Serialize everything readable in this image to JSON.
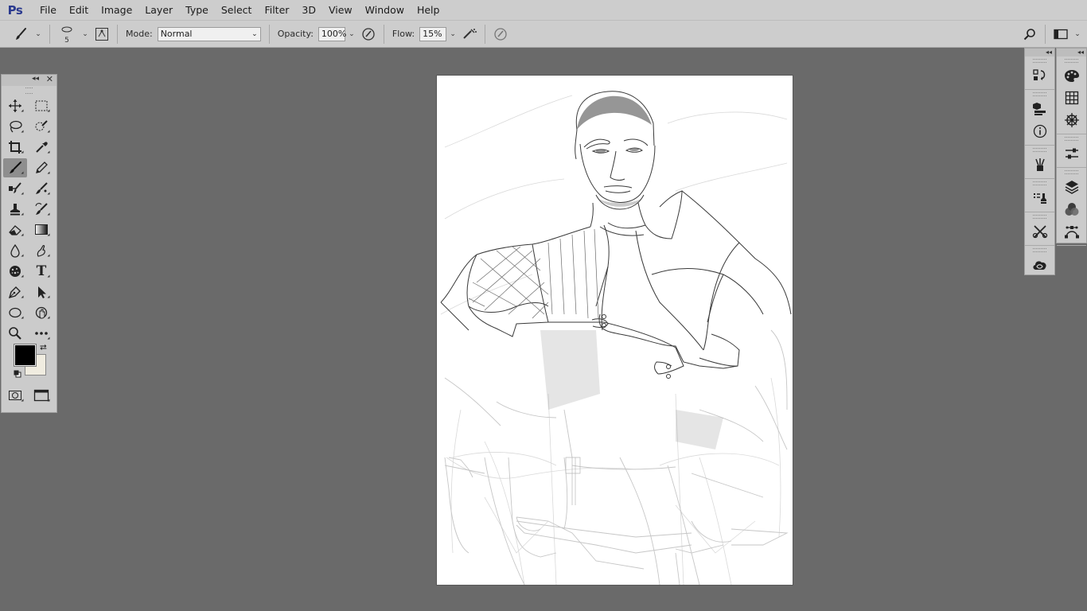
{
  "app": {
    "logo_text": "Ps"
  },
  "menu": {
    "items": [
      "File",
      "Edit",
      "Image",
      "Layer",
      "Type",
      "Select",
      "Filter",
      "3D",
      "View",
      "Window",
      "Help"
    ]
  },
  "options": {
    "brush_size": "5",
    "mode_label": "Mode:",
    "mode_value": "Normal",
    "opacity_label": "Opacity:",
    "opacity_value": "100%",
    "flow_label": "Flow:",
    "flow_value": "15%"
  },
  "tools": {
    "active": "brush-tool",
    "foreground_color": "#000000",
    "background_color": "#f0ece0"
  },
  "colors": {
    "workspace": "#6a6a6a",
    "chrome": "#cdcdcd",
    "canvas": "#ffffff"
  },
  "canvas": {
    "content": "pencil sketch of armored warrior holding a sword"
  }
}
